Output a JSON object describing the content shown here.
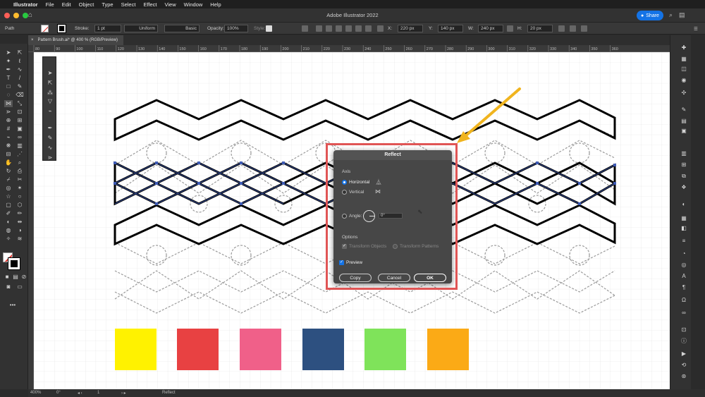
{
  "menubar": {
    "app_name": "Illustrator",
    "items": [
      "File",
      "Edit",
      "Object",
      "Type",
      "Select",
      "Effect",
      "View",
      "Window",
      "Help"
    ]
  },
  "window": {
    "title": "Adobe Illustrator 2022",
    "share_label": "Share"
  },
  "control_bar": {
    "selection_label": "Path",
    "stroke_label": "Stroke:",
    "stroke_weight": "1 pt",
    "profile": "Uniform",
    "brush": "Basic",
    "opacity_label": "Opacity:",
    "opacity_value": "100%",
    "style_label": "Style:",
    "x_label": "X:",
    "x_value": "220 px",
    "y_label": "Y:",
    "y_value": "140 px",
    "w_label": "W:",
    "w_value": "240 px",
    "h_label": "H:",
    "h_value": "20 px"
  },
  "document": {
    "tab_label": "Pattern Brush.ai* @ 400 % (RGB/Preview)"
  },
  "ruler_ticks": [
    "80",
    "90",
    "100",
    "110",
    "120",
    "130",
    "140",
    "150",
    "160",
    "170",
    "180",
    "190",
    "200",
    "210",
    "220",
    "230",
    "240",
    "250",
    "260",
    "270",
    "280",
    "290",
    "300",
    "310",
    "320",
    "330",
    "340",
    "350",
    "360"
  ],
  "swatches": [
    {
      "name": "yellow",
      "color": "#fff200"
    },
    {
      "name": "red",
      "color": "#e84142"
    },
    {
      "name": "pink",
      "color": "#f06089"
    },
    {
      "name": "navy",
      "color": "#2d5080"
    },
    {
      "name": "green",
      "color": "#7fe35a"
    },
    {
      "name": "orange",
      "color": "#fbaa16"
    }
  ],
  "dialog": {
    "title": "Reflect",
    "axis_label": "Axis",
    "horizontal_label": "Horizontal",
    "vertical_label": "Vertical",
    "angle_label": "Angle:",
    "angle_value": "0°",
    "options_label": "Options",
    "transform_objects_label": "Transform Objects",
    "transform_patterns_label": "Transform Patterns",
    "preview_label": "Preview",
    "copy_label": "Copy",
    "cancel_label": "Cancel",
    "ok_label": "OK",
    "selected_axis": "Horizontal",
    "preview_checked": true
  },
  "status_bar": {
    "zoom": "400%",
    "rotation": "0°",
    "artboard": "1",
    "tool_status": "Reflect"
  },
  "colors": {
    "accent": "#1473e6",
    "highlight_box": "#e05555",
    "arrow": "#f0b41e",
    "selection_path": "#3d5ab4"
  }
}
